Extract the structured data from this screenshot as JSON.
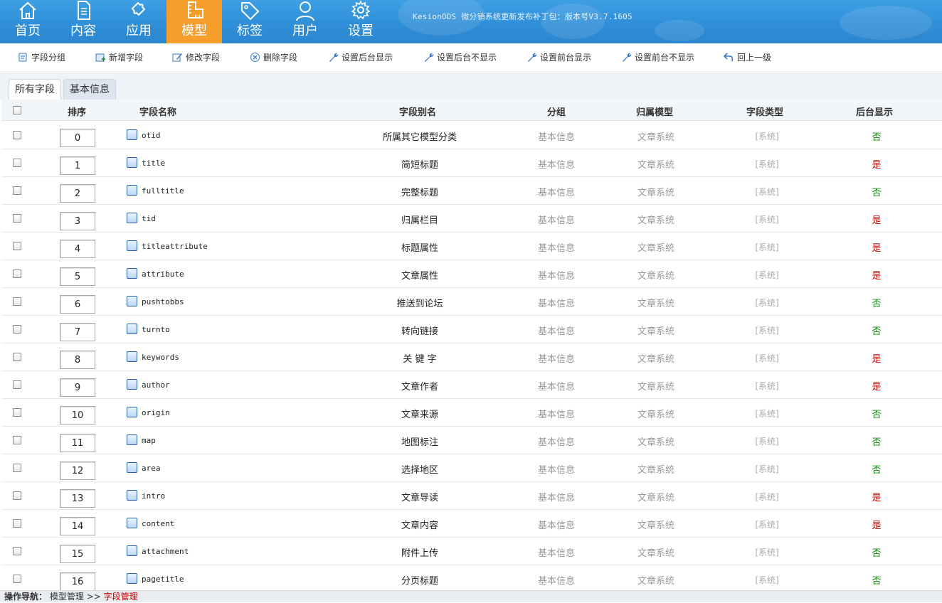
{
  "nav": {
    "items": [
      {
        "label": "首页",
        "icon": "home-icon"
      },
      {
        "label": "内容",
        "icon": "document-icon"
      },
      {
        "label": "应用",
        "icon": "puzzle-icon"
      },
      {
        "label": "模型",
        "icon": "ruler-icon"
      },
      {
        "label": "标签",
        "icon": "tag-icon"
      },
      {
        "label": "用户",
        "icon": "user-icon"
      },
      {
        "label": "设置",
        "icon": "gear-icon"
      }
    ],
    "active": "模型",
    "notice": "KesionODS 微分销系统更新发布补丁包：版本号V3.7.1605"
  },
  "toolbar": {
    "buttons": [
      {
        "label": "字段分组",
        "icon": "group-icon"
      },
      {
        "label": "新增字段",
        "icon": "add-field-icon"
      },
      {
        "label": "修改字段",
        "icon": "edit-icon"
      },
      {
        "label": "删除字段",
        "icon": "delete-icon"
      },
      {
        "label": "设置后台显示",
        "icon": "wrench-icon"
      },
      {
        "label": "设置后台不显示",
        "icon": "wrench-icon"
      },
      {
        "label": "设置前台显示",
        "icon": "wrench-icon"
      },
      {
        "label": "设置前台不显示",
        "icon": "wrench-icon"
      },
      {
        "label": "回上一级",
        "icon": "back-arrow-icon"
      }
    ]
  },
  "tabs": [
    {
      "label": "所有字段",
      "active": true
    },
    {
      "label": "基本信息",
      "active": false
    }
  ],
  "table": {
    "headers": {
      "sort": "排序",
      "name": "字段名称",
      "alias": "字段别名",
      "group": "分组",
      "model": "归属模型",
      "type": "字段类型",
      "show": "后台显示"
    },
    "rows": [
      {
        "sort": "0",
        "name": "otid",
        "alias": "所属其它模型分类",
        "group": "基本信息",
        "model": "文章系统",
        "type": "[系统]",
        "show": "否"
      },
      {
        "sort": "1",
        "name": "title",
        "alias": "简短标题",
        "group": "基本信息",
        "model": "文章系统",
        "type": "[系统]",
        "show": "是"
      },
      {
        "sort": "2",
        "name": "fulltitle",
        "alias": "完整标题",
        "group": "基本信息",
        "model": "文章系统",
        "type": "[系统]",
        "show": "否"
      },
      {
        "sort": "3",
        "name": "tid",
        "alias": "归属栏目",
        "group": "基本信息",
        "model": "文章系统",
        "type": "[系统]",
        "show": "是"
      },
      {
        "sort": "4",
        "name": "titleattribute",
        "alias": "标题属性",
        "group": "基本信息",
        "model": "文章系统",
        "type": "[系统]",
        "show": "是"
      },
      {
        "sort": "5",
        "name": "attribute",
        "alias": "文章属性",
        "group": "基本信息",
        "model": "文章系统",
        "type": "[系统]",
        "show": "是"
      },
      {
        "sort": "6",
        "name": "pushtobbs",
        "alias": "推送到论坛",
        "group": "基本信息",
        "model": "文章系统",
        "type": "[系统]",
        "show": "否"
      },
      {
        "sort": "7",
        "name": "turnto",
        "alias": "转向链接",
        "group": "基本信息",
        "model": "文章系统",
        "type": "[系统]",
        "show": "否"
      },
      {
        "sort": "8",
        "name": "keywords",
        "alias": "关 键 字",
        "group": "基本信息",
        "model": "文章系统",
        "type": "[系统]",
        "show": "是"
      },
      {
        "sort": "9",
        "name": "author",
        "alias": "文章作者",
        "group": "基本信息",
        "model": "文章系统",
        "type": "[系统]",
        "show": "是"
      },
      {
        "sort": "10",
        "name": "origin",
        "alias": "文章来源",
        "group": "基本信息",
        "model": "文章系统",
        "type": "[系统]",
        "show": "否"
      },
      {
        "sort": "11",
        "name": "map",
        "alias": "地图标注",
        "group": "基本信息",
        "model": "文章系统",
        "type": "[系统]",
        "show": "否"
      },
      {
        "sort": "12",
        "name": "area",
        "alias": "选择地区",
        "group": "基本信息",
        "model": "文章系统",
        "type": "[系统]",
        "show": "否"
      },
      {
        "sort": "13",
        "name": "intro",
        "alias": "文章导读",
        "group": "基本信息",
        "model": "文章系统",
        "type": "[系统]",
        "show": "是"
      },
      {
        "sort": "14",
        "name": "content",
        "alias": "文章内容",
        "group": "基本信息",
        "model": "文章系统",
        "type": "[系统]",
        "show": "是"
      },
      {
        "sort": "15",
        "name": "attachment",
        "alias": "附件上传",
        "group": "基本信息",
        "model": "文章系统",
        "type": "[系统]",
        "show": "否"
      },
      {
        "sort": "16",
        "name": "pagetitle",
        "alias": "分页标题",
        "group": "基本信息",
        "model": "文章系统",
        "type": "[系统]",
        "show": "否"
      }
    ]
  },
  "statusbar": {
    "lead": "操作导航：",
    "crumb": "模型管理",
    "sep": ">>",
    "current": "字段管理"
  },
  "colors": {
    "nav_bg": "#2f8fd8",
    "nav_active": "#f59e2c",
    "yes": "#cc0000",
    "no": "#0a8a0a"
  }
}
